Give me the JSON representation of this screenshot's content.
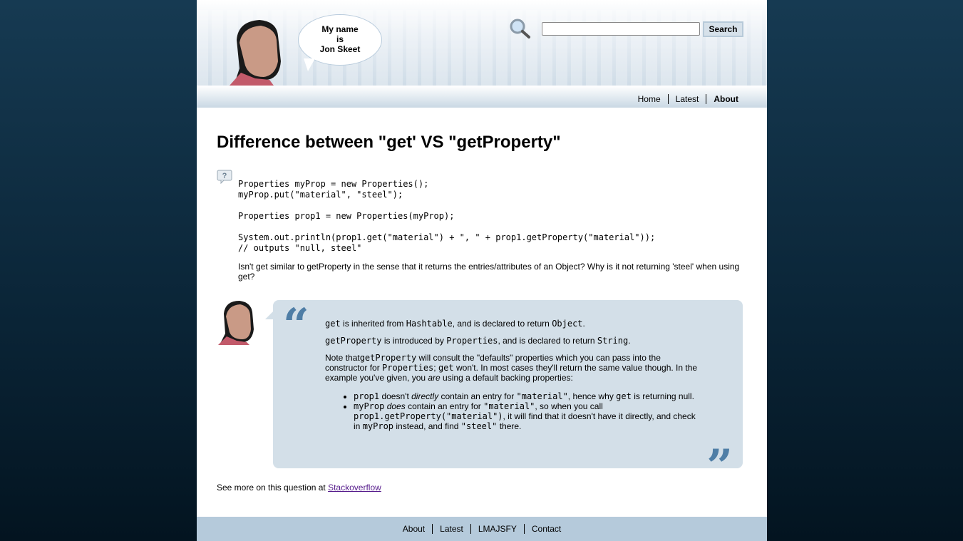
{
  "header": {
    "bubble_lines": [
      "My name",
      "is",
      "Jon Skeet"
    ],
    "search_placeholder": "",
    "search_button": "Search"
  },
  "nav": [
    {
      "label": "Home"
    },
    {
      "label": "Latest"
    },
    {
      "label": "About",
      "current": true
    }
  ],
  "title": "Difference between \"get' VS \"getProperty\"",
  "question": {
    "code": "Properties myProp = new Properties();\nmyProp.put(\"material\", \"steel\");\n\nProperties prop1 = new Properties(myProp);\n\nSystem.out.println(prop1.get(\"material\") + \", \" + prop1.getProperty(\"material\"));\n// outputs \"null, steel\"",
    "text": "Isn't get similar to getProperty in the sense that it returns the entries/attributes of an Object? Why is it not returning 'steel' when using get?"
  },
  "answer": {
    "paragraphs": [
      [
        {
          "c": "get"
        },
        {
          "t": " is inherited from "
        },
        {
          "c": "Hashtable"
        },
        {
          "t": ", and is declared to return "
        },
        {
          "c": "Object"
        },
        {
          "t": "."
        }
      ],
      [
        {
          "c": "getProperty"
        },
        {
          "t": " is introduced by "
        },
        {
          "c": "Properties"
        },
        {
          "t": ", and is declared to return "
        },
        {
          "c": "String"
        },
        {
          "t": "."
        }
      ],
      [
        {
          "t": "Note that"
        },
        {
          "c": "getProperty"
        },
        {
          "t": " will consult the \"defaults\" properties which you can pass into the constructor for "
        },
        {
          "c": "Properties"
        },
        {
          "t": "; "
        },
        {
          "c": "get"
        },
        {
          "t": " won't. In most cases they'll return the same value though. In the example you've given, you "
        },
        {
          "e": "are"
        },
        {
          "t": " using a default backing properties:"
        }
      ]
    ],
    "bullets": [
      [
        {
          "c": "prop1"
        },
        {
          "t": " doesn't "
        },
        {
          "e": "directly"
        },
        {
          "t": " contain an entry for "
        },
        {
          "c": "\"material\""
        },
        {
          "t": ", hence why "
        },
        {
          "c": "get"
        },
        {
          "t": " is returning null."
        }
      ],
      [
        {
          "c": "myProp"
        },
        {
          "t": " "
        },
        {
          "e": "does"
        },
        {
          "t": " contain an entry for "
        },
        {
          "c": "\"material\""
        },
        {
          "t": ", so when you call "
        },
        {
          "c": "prop1.getProperty(\"material\")"
        },
        {
          "t": ", it will find that it doesn't have it directly, and check in "
        },
        {
          "c": "myProp"
        },
        {
          "t": " instead, and find "
        },
        {
          "c": "\"steel\""
        },
        {
          "t": " there."
        }
      ]
    ]
  },
  "more": {
    "prefix": "See more on this question at ",
    "link": "Stackoverflow"
  },
  "footer": [
    {
      "label": "About"
    },
    {
      "label": "Latest"
    },
    {
      "label": "LMAJSFY"
    },
    {
      "label": "Contact"
    }
  ],
  "colors": {
    "accent": "#4f7ea6",
    "answer_bg": "#d3dfe8",
    "footer_bg": "#b5cadb"
  }
}
